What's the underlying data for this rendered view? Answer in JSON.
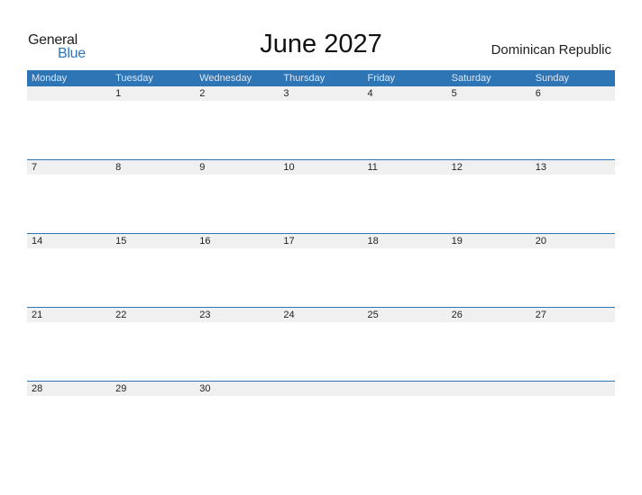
{
  "logo": {
    "part1": "General",
    "part2": "Blue"
  },
  "title": "June 2027",
  "country": "Dominican Republic",
  "colors": {
    "accent": "#2e75b6",
    "day_row_bg": "#f0f0f0"
  },
  "weekdays": [
    "Monday",
    "Tuesday",
    "Wednesday",
    "Thursday",
    "Friday",
    "Saturday",
    "Sunday"
  ],
  "weeks": [
    [
      "",
      "1",
      "2",
      "3",
      "4",
      "5",
      "6"
    ],
    [
      "7",
      "8",
      "9",
      "10",
      "11",
      "12",
      "13"
    ],
    [
      "14",
      "15",
      "16",
      "17",
      "18",
      "19",
      "20"
    ],
    [
      "21",
      "22",
      "23",
      "24",
      "25",
      "26",
      "27"
    ],
    [
      "28",
      "29",
      "30",
      "",
      "",
      "",
      ""
    ]
  ]
}
